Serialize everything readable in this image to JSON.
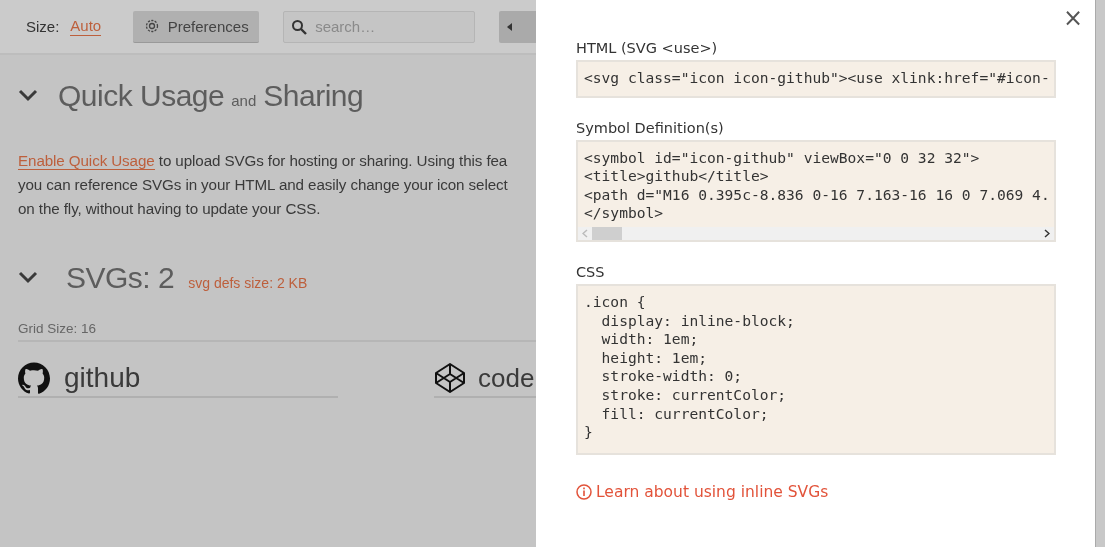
{
  "toolbar": {
    "size_label": "Size:",
    "size_value": "Auto",
    "preferences_button": "Preferences",
    "search": {
      "placeholder": "search…"
    }
  },
  "sections": [
    {
      "kind": "intro",
      "expanded": true,
      "title": "Quick Usage",
      "title_joiner": "and",
      "title_end": "Sharing",
      "link": "Enable Quick Usage",
      "lines": [
        " to upload SVGs for hosting or sharing. Using this fea",
        "you can reference SVGs in your HTML and easily change your icon select",
        "on the fly, without having to update your CSS."
      ]
    },
    {
      "kind": "svgs",
      "expanded": true,
      "title": "SVGs: 2",
      "note": "svg defs size: 2 KB",
      "grid_label": "Grid Size: 16",
      "icons": [
        {
          "kind": "github",
          "name": "github"
        },
        {
          "kind": "codepen",
          "name": "code"
        }
      ]
    }
  ],
  "panel": {
    "close": "×",
    "blocks": [
      {
        "label": "HTML (SVG <use>)",
        "horizontal_scrollbar": false,
        "lines": [
          "<svg class=\"icon icon-github\"><use xlink:href=\"#icon-"
        ]
      },
      {
        "label": "Symbol Definition(s)",
        "horizontal_scrollbar": true,
        "lines": [
          "<symbol id=\"icon-github\" viewBox=\"0 0 32 32\">",
          "<title>github</title>",
          "<path d=\"M16 0.395c-8.836 0-16 7.163-16 16 0 7.069 4.",
          "</symbol>"
        ]
      },
      {
        "label": "CSS",
        "horizontal_scrollbar": false,
        "lines": [
          ".icon {",
          "  display: inline-block;",
          "  width: 1em;",
          "  height: 1em;",
          "  stroke-width: 0;",
          "  stroke: currentColor;",
          "  fill: currentColor;",
          "}"
        ]
      }
    ],
    "link": "Learn about using inline SVGs"
  }
}
